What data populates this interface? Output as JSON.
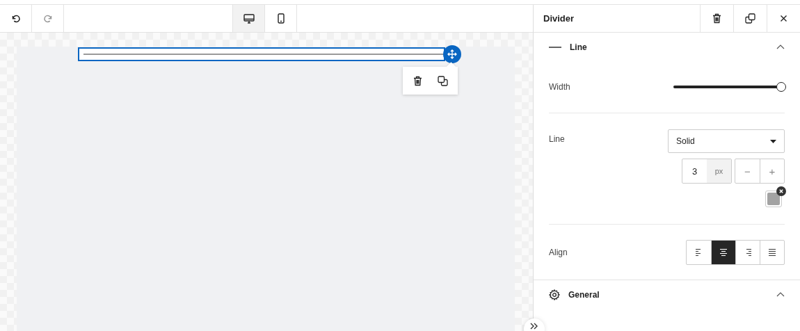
{
  "toolbar": {
    "history": [
      {
        "kind": "undo",
        "disabled": false
      },
      {
        "kind": "redo",
        "disabled": true
      }
    ],
    "devices": [
      {
        "kind": "desktop",
        "selected": true
      },
      {
        "kind": "mobile",
        "selected": false
      }
    ]
  },
  "panel": {
    "title": "Divider",
    "sections": [
      {
        "title": "Line",
        "expanded": true
      },
      {
        "title": "General",
        "expanded": true
      }
    ],
    "width": {
      "label": "Width",
      "level": 1
    },
    "line": {
      "label": "Line",
      "style": "Solid",
      "thickness": "3",
      "unit": "px",
      "decrement": "−",
      "increment": "+",
      "color": "#a3a3a3"
    },
    "align": {
      "label": "Align",
      "options": [
        {
          "kind": "left",
          "selected": false
        },
        {
          "kind": "center",
          "selected": true
        },
        {
          "kind": "right",
          "selected": false
        },
        {
          "kind": "justify",
          "selected": false
        }
      ]
    }
  }
}
